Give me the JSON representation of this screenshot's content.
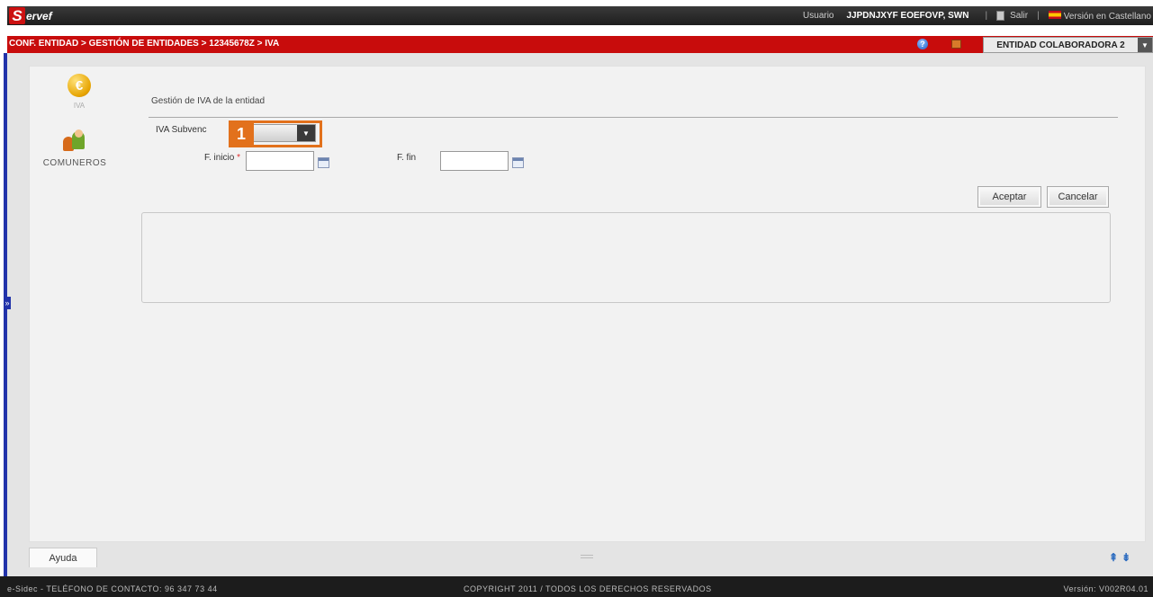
{
  "header": {
    "logo_letter": "S",
    "logo_text": "ervef",
    "user_label": "Usuario",
    "user_name": "JJPDNJXYF EOEFOVP, SWN",
    "exit_label": "Salir",
    "language_label": "Versión en Castellano"
  },
  "breadcrumb": {
    "path": "CONF. ENTIDAD > GESTIÓN DE ENTIDADES > 12345678Z > IVA",
    "help_icon_glyph": "?",
    "entity_selected": "ENTIDAD COLABORADORA 2"
  },
  "sidebar": {
    "items": [
      {
        "label": "IVA",
        "icon": "euro-icon",
        "icon_glyph": "€"
      },
      {
        "label": "COMUNEROS",
        "icon": "people-icon"
      }
    ]
  },
  "form": {
    "section_title": "Gestión de IVA de la entidad",
    "iva_subvencionable_label": "IVA Subvenc",
    "iva_subvencionable_value": "",
    "start_date_label": "F. inicio",
    "start_date_value": "",
    "end_date_label": "F. fin",
    "end_date_value": "",
    "required_mark": "*",
    "callout_number": "1"
  },
  "actions": {
    "accept_label": "Aceptar",
    "cancel_label": "Cancelar"
  },
  "bottom": {
    "help_tab_label": "Ayuda"
  },
  "footer": {
    "contact": "e-Sidec - TELÉFONO DE CONTACTO: 96 347 73 44",
    "copyright": "COPYRIGHT 2011 / TODOS LOS DERECHOS RESERVADOS",
    "version": "Versión: V002R04.01"
  },
  "colors": {
    "brand_red": "#c80c0c",
    "callout_orange": "#e2711c",
    "top_bar": "#2a2a2a"
  }
}
